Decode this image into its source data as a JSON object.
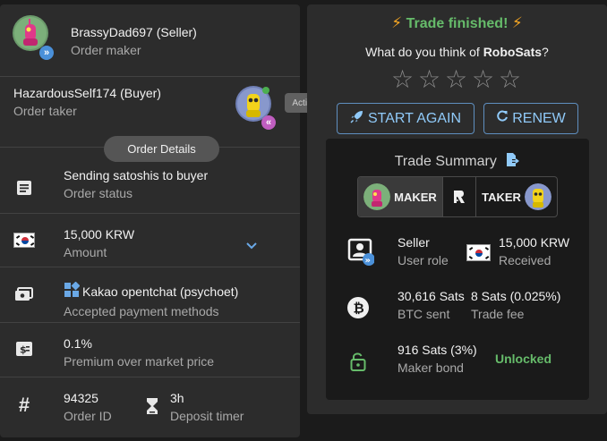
{
  "maker": {
    "name": "BrassyDad697 (Seller)",
    "role": "Order maker"
  },
  "taker": {
    "name": "HazardousSelf174 (Buyer)",
    "role": "Order taker",
    "tooltip": "Active"
  },
  "details_chip": "Order Details",
  "status": {
    "value": "Sending satoshis to buyer",
    "label": "Order status"
  },
  "amount": {
    "value": "15,000 KRW",
    "label": "Amount"
  },
  "payment": {
    "value": "Kakao opentchat (psychoet)",
    "label": "Accepted payment methods"
  },
  "premium": {
    "value": "0.1%",
    "label": "Premium over market price"
  },
  "order_id": {
    "value": "94325",
    "label": "Order ID"
  },
  "timer": {
    "value": "3h",
    "label": "Deposit timer"
  },
  "finished": {
    "title": "Trade finished!",
    "question_prefix": "What do you think of ",
    "brand": "RoboSats",
    "question_suffix": "?"
  },
  "rating": {
    "max_stars": 5,
    "selected": 0
  },
  "buttons": {
    "start_again": "START AGAIN",
    "renew": "RENEW"
  },
  "summary": {
    "title": "Trade Summary",
    "maker_label": "MAKER",
    "taker_label": "TAKER",
    "user_role": {
      "value": "Seller",
      "label": "User role"
    },
    "received": {
      "value": "15,000 KRW",
      "label": "Received"
    },
    "btc_sent": {
      "value": "30,616 Sats",
      "label": "BTC sent"
    },
    "trade_fee": {
      "value": "8 Sats (0.025%)",
      "label": "Trade fee"
    },
    "maker_bond": {
      "value": "916 Sats (3%)",
      "label": "Maker bond"
    },
    "bond_status": "Unlocked"
  },
  "colors": {
    "accent_green": "#66bb6a",
    "button_blue": "#90caf9",
    "bolt": "#f5a623"
  }
}
